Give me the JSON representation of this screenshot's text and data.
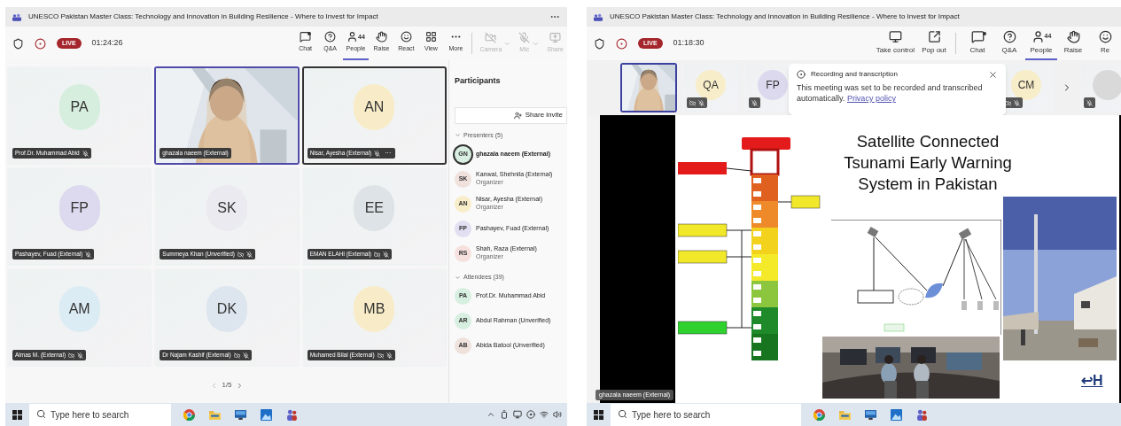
{
  "left_window": {
    "title": "UNESCO Pakistan Master Class: Technology and Innovation in Building Resilience - Where to Invest for Impact",
    "live": "LIVE",
    "timer": "01:24:26",
    "toolbar": [
      {
        "kind": "chat",
        "label": "Chat",
        "selected": false,
        "unread": true
      },
      {
        "kind": "qa",
        "label": "Q&A",
        "selected": false,
        "unread": false
      },
      {
        "kind": "people",
        "label": "People",
        "count": "44",
        "selected": true,
        "unread": false
      },
      {
        "kind": "raise",
        "label": "Raise",
        "selected": false,
        "unread": false
      },
      {
        "kind": "react",
        "label": "React",
        "selected": false,
        "unread": false
      },
      {
        "kind": "view",
        "label": "View",
        "selected": false,
        "unread": false
      },
      {
        "kind": "more",
        "label": "More",
        "selected": false,
        "unread": false
      }
    ],
    "device_controls": [
      {
        "kind": "camera",
        "label": "Camera",
        "disabled": true,
        "dropdown": true
      },
      {
        "kind": "mic",
        "label": "Mic",
        "disabled": true,
        "dropdown": true
      },
      {
        "kind": "share",
        "label": "Share",
        "disabled": true,
        "dropdown": false
      }
    ],
    "tile_rows": [
      [
        {
          "kind": "avatar",
          "name": "Prof.Dr. Muhammad Abid",
          "initials": "PA",
          "color": "#d6eedd",
          "speaking": false,
          "focused": false,
          "muted": true,
          "camera_off": false
        },
        {
          "kind": "video",
          "name": "ghazala naeem (External)",
          "speaking": true,
          "focused": false
        },
        {
          "kind": "avatar",
          "name": "Nisar, Ayesha (External)",
          "initials": "AN",
          "color": "#f8ecc8",
          "speaking": false,
          "focused": true,
          "muted": true,
          "camera_off": false,
          "more": "···"
        }
      ],
      [
        {
          "kind": "avatar",
          "name": "Pashayev, Fuad (External)",
          "initials": "FP",
          "color": "#ddd9ee",
          "speaking": false,
          "focused": false,
          "muted": true,
          "camera_off": false
        },
        {
          "kind": "avatar",
          "name": "Summeya Khan (Unverified)",
          "initials": "SK",
          "color": "#ebeaf0",
          "speaking": false,
          "focused": false,
          "muted": true,
          "camera_off": true
        },
        {
          "kind": "avatar",
          "name": "EMAN ELAHI (External)",
          "initials": "EE",
          "color": "#dde3e6",
          "speaking": false,
          "focused": false,
          "muted": true,
          "camera_off": true
        }
      ],
      [
        {
          "kind": "avatar",
          "name": "Almas M. (External)",
          "initials": "AM",
          "color": "#dcecf4",
          "speaking": false,
          "focused": false,
          "muted": true,
          "camera_off": true
        },
        {
          "kind": "avatar",
          "name": "Dr Najam Kashif (External)",
          "initials": "DK",
          "color": "#dde5ef",
          "speaking": false,
          "focused": false,
          "muted": true,
          "camera_off": true
        },
        {
          "kind": "avatar",
          "name": "Muhamed Bilal (External)",
          "initials": "MB",
          "color": "#f8ecc8",
          "speaking": false,
          "focused": false,
          "muted": true,
          "camera_off": true
        }
      ]
    ],
    "pager": "1/5",
    "participants": {
      "title": "Participants",
      "share_invite": "Share invite",
      "groups": [
        {
          "label": "Presenters (5)",
          "expanded": true,
          "people": [
            {
              "initials": "GN",
              "name": "ghazala naeem (External)",
              "color": "#d8efe1",
              "speaking": true
            },
            {
              "initials": "SK",
              "name": "Kanwal, Shehnila (External)",
              "role": "Organizer",
              "color": "#f0e1dc",
              "speaking": false
            },
            {
              "initials": "AN",
              "name": "Nisar, Ayesha (External)",
              "role": "Organizer",
              "color": "#f8edc9",
              "speaking": false
            },
            {
              "initials": "FP",
              "name": "Pashayev, Fuad (External)",
              "color": "#e2dff2",
              "speaking": false
            },
            {
              "initials": "RS",
              "name": "Shah, Raza (External)",
              "role": "Organizer",
              "color": "#f6e0dd",
              "speaking": false
            }
          ]
        },
        {
          "label": "Attendees (39)",
          "expanded": true,
          "people": [
            {
              "initials": "PA",
              "name": "Prof.Dr. Muhammad Abid",
              "color": "#d7efe0",
              "speaking": false
            },
            {
              "initials": "AR",
              "name": "Abdul Rahman (Unverified)",
              "color": "#d7efe0",
              "speaking": false
            },
            {
              "initials": "AB",
              "name": "Abida Batool (Unverified)",
              "color": "#efe2dc",
              "speaking": false
            }
          ]
        }
      ]
    },
    "taskbar": {
      "search_placeholder": "Type here to search",
      "tray": true
    }
  },
  "right_window": {
    "title": "UNESCO Pakistan Master Class: Technology and Innovation in Building Resilience - Where to Invest for Impact",
    "live": "LIVE",
    "timer": "01:18:30",
    "share_controls": [
      {
        "kind": "take_control",
        "label": "Take control"
      },
      {
        "kind": "popout",
        "label": "Pop out"
      }
    ],
    "toolbar": [
      {
        "kind": "chat",
        "label": "Chat",
        "selected": false,
        "unread": true
      },
      {
        "kind": "qa",
        "label": "Q&A",
        "selected": false,
        "unread": false
      },
      {
        "kind": "people",
        "label": "People",
        "count": "44",
        "selected": true,
        "unread": false
      },
      {
        "kind": "raise",
        "label": "Raise",
        "selected": false,
        "unread": false
      },
      {
        "kind": "react",
        "label": "Re",
        "selected": false,
        "unread": false
      }
    ],
    "filmstrip": [
      {
        "kind": "video",
        "selected": true
      },
      {
        "kind": "avatar",
        "initials": "QA",
        "color": "#f8edc9",
        "selected": false,
        "muted": true,
        "camera_off": true
      },
      {
        "kind": "avatar",
        "initials": "FP",
        "color": "#dcd9ef",
        "selected": false,
        "muted": true,
        "camera_off": false
      },
      {
        "kind": "gap"
      },
      {
        "kind": "avatar",
        "initials": "CM",
        "color": "#f8edc9",
        "selected": false,
        "muted": true,
        "camera_off": true
      },
      {
        "kind": "next"
      },
      {
        "kind": "avatar",
        "color": "#d9d9d9",
        "selected": false,
        "muted": true
      }
    ],
    "notice": {
      "title": "Recording and transcription",
      "body": "This meeting was set to be recorded and transcribed automatically.",
      "link": "Privacy policy"
    },
    "slide": {
      "title": "Satellite Connected Tsunami Early Warning System in Pakistan",
      "link": "↩H",
      "presenter": "ghazala naeem (External)"
    },
    "taskbar": {
      "search_placeholder": "Type here to search",
      "tray": false
    }
  }
}
